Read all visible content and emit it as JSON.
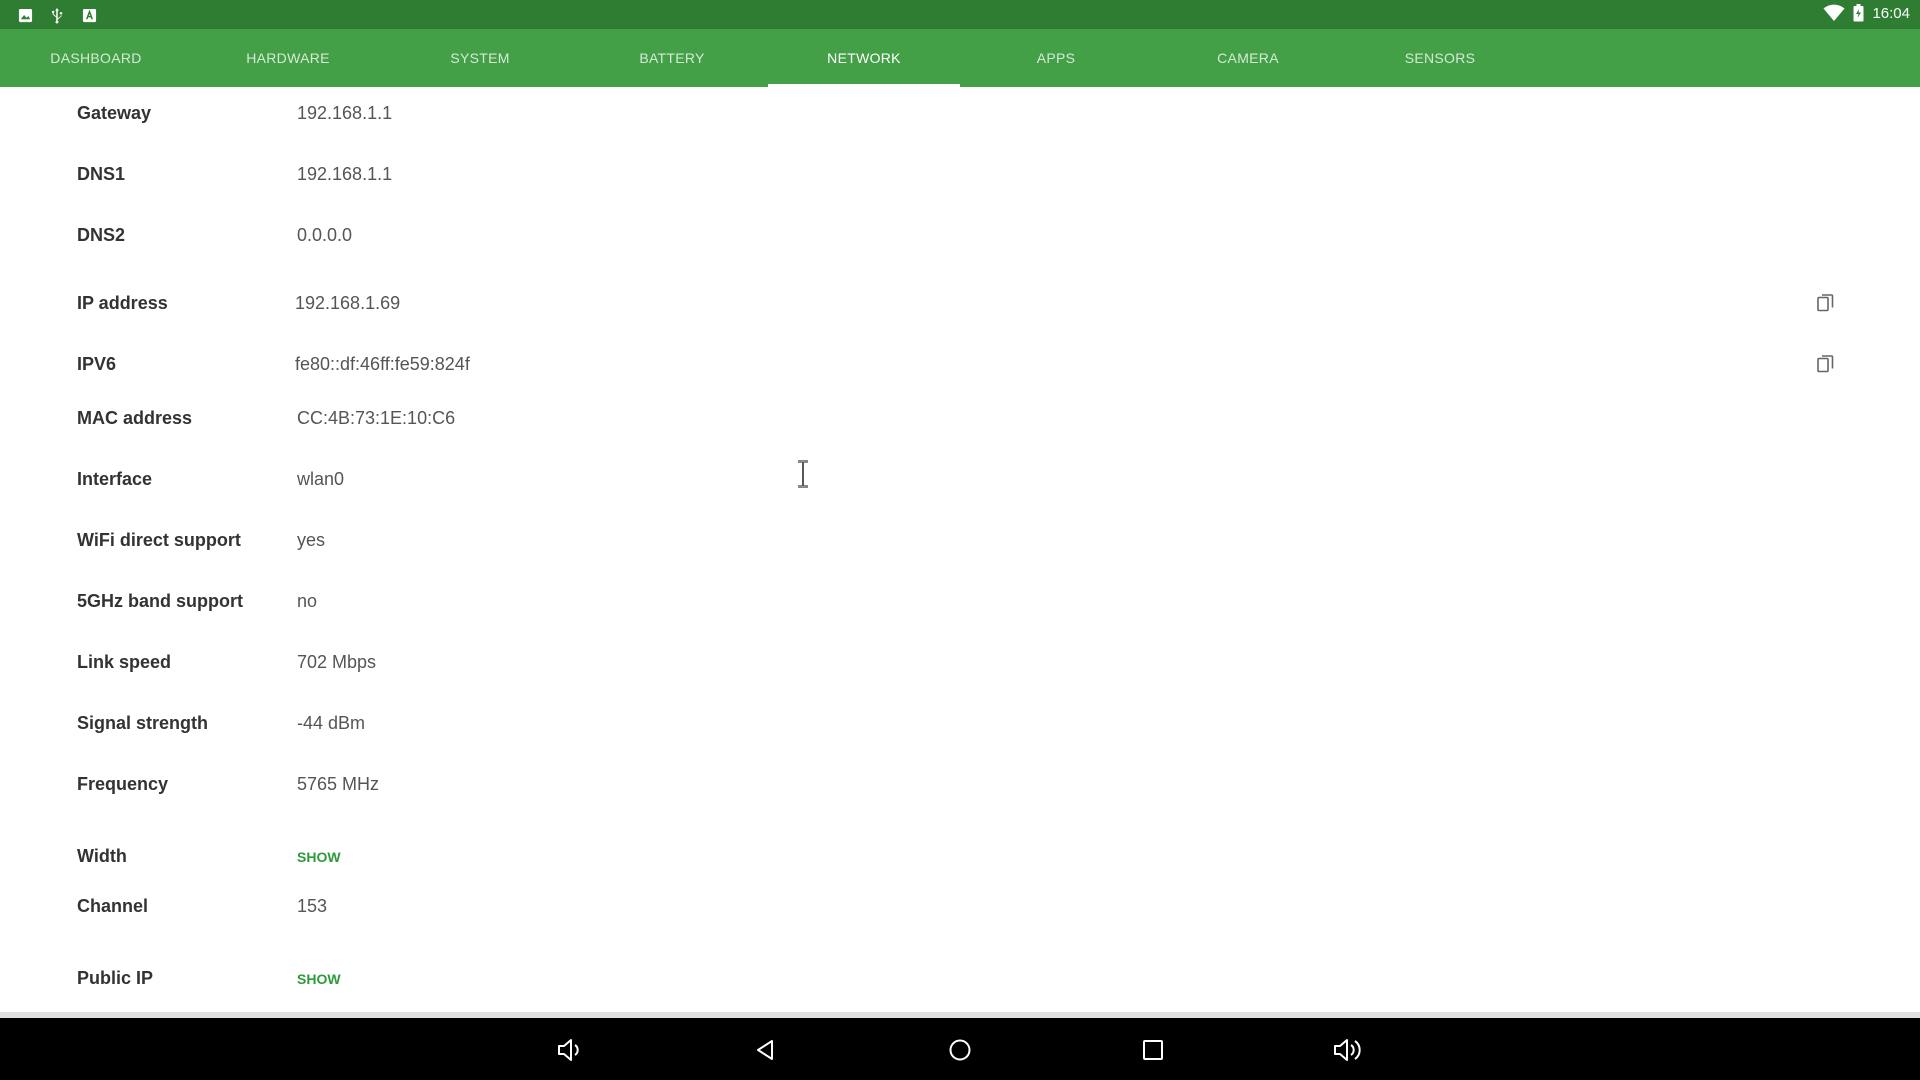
{
  "status_bar": {
    "time": "16:04",
    "left_icons": [
      "image-icon",
      "usb-icon",
      "text-icon"
    ],
    "right_icons": [
      "wifi-icon",
      "battery-icon"
    ]
  },
  "tabs": [
    {
      "label": "DASHBOARD"
    },
    {
      "label": "HARDWARE"
    },
    {
      "label": "SYSTEM"
    },
    {
      "label": "BATTERY"
    },
    {
      "label": "NETWORK",
      "active": true
    },
    {
      "label": "APPS"
    },
    {
      "label": "CAMERA"
    },
    {
      "label": "SENSORS"
    }
  ],
  "rows": [
    {
      "label": "Gateway",
      "value": "192.168.1.1"
    },
    {
      "label": "DNS1",
      "value": "192.168.1.1"
    },
    {
      "label": "DNS2",
      "value": "0.0.0.0"
    },
    {
      "label": "IP address",
      "value": "192.168.1.69",
      "copy": true
    },
    {
      "label": "IPV6",
      "value": "fe80::df:46ff:fe59:824f",
      "copy": true
    },
    {
      "label": "MAC address",
      "value": "CC:4B:73:1E:10:C6"
    },
    {
      "label": "Interface",
      "value": "wlan0"
    },
    {
      "label": "WiFi direct support",
      "value": "yes"
    },
    {
      "label": "5GHz band support",
      "value": "no"
    },
    {
      "label": "Link speed",
      "value": "702 Mbps"
    },
    {
      "label": "Signal strength",
      "value": "-44 dBm"
    },
    {
      "label": "Frequency",
      "value": "5765 MHz"
    },
    {
      "label": "Width",
      "link": "SHOW"
    },
    {
      "label": "Channel",
      "value": "153"
    },
    {
      "label": "Public IP",
      "link": "SHOW"
    }
  ],
  "colors": {
    "status_bar": "#2e7d32",
    "tab_bar": "#43a047",
    "accent_link": "#2e9b3a"
  }
}
